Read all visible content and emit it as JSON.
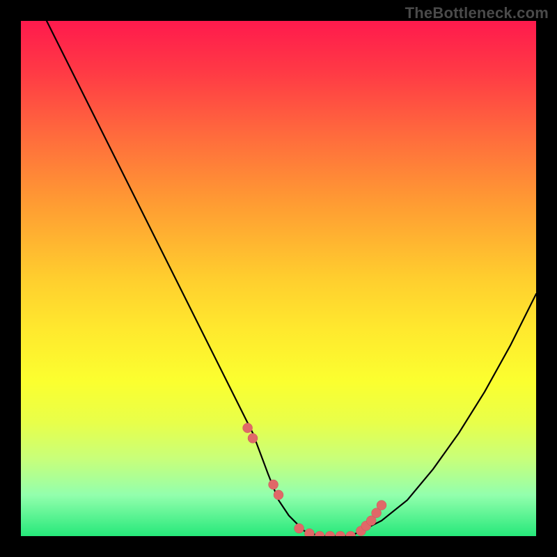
{
  "watermark": "TheBottleneck.com",
  "palette": {
    "background_frame": "#000000",
    "gradient_top": "#ff1a4d",
    "gradient_mid": "#ffe92e",
    "gradient_bottom": "#26e87a",
    "curve": "#000000",
    "marker": "#e06868"
  },
  "chart_data": {
    "type": "line",
    "title": "",
    "xlabel": "",
    "ylabel": "",
    "xlim": [
      0,
      100
    ],
    "ylim": [
      0,
      100
    ],
    "grid": false,
    "legend": false,
    "series": [
      {
        "name": "bottleneck-curve",
        "x": [
          5,
          10,
          15,
          20,
          25,
          30,
          35,
          40,
          45,
          48,
          50,
          52,
          55,
          58,
          60,
          62,
          64,
          66,
          70,
          75,
          80,
          85,
          90,
          95,
          100
        ],
        "values": [
          100,
          90,
          80,
          70,
          60,
          50,
          40,
          30,
          20,
          12,
          7,
          4,
          1,
          0,
          0,
          0,
          0,
          1,
          3,
          7,
          13,
          20,
          28,
          37,
          47
        ]
      }
    ],
    "markers": {
      "name": "highlighted-points",
      "x": [
        44,
        45,
        49,
        50,
        54,
        56,
        58,
        60,
        62,
        64,
        66,
        67,
        68,
        69,
        70
      ],
      "values": [
        21,
        19,
        10,
        8,
        1.5,
        0.5,
        0,
        0,
        0,
        0,
        1,
        2,
        3,
        4.5,
        6
      ]
    }
  }
}
